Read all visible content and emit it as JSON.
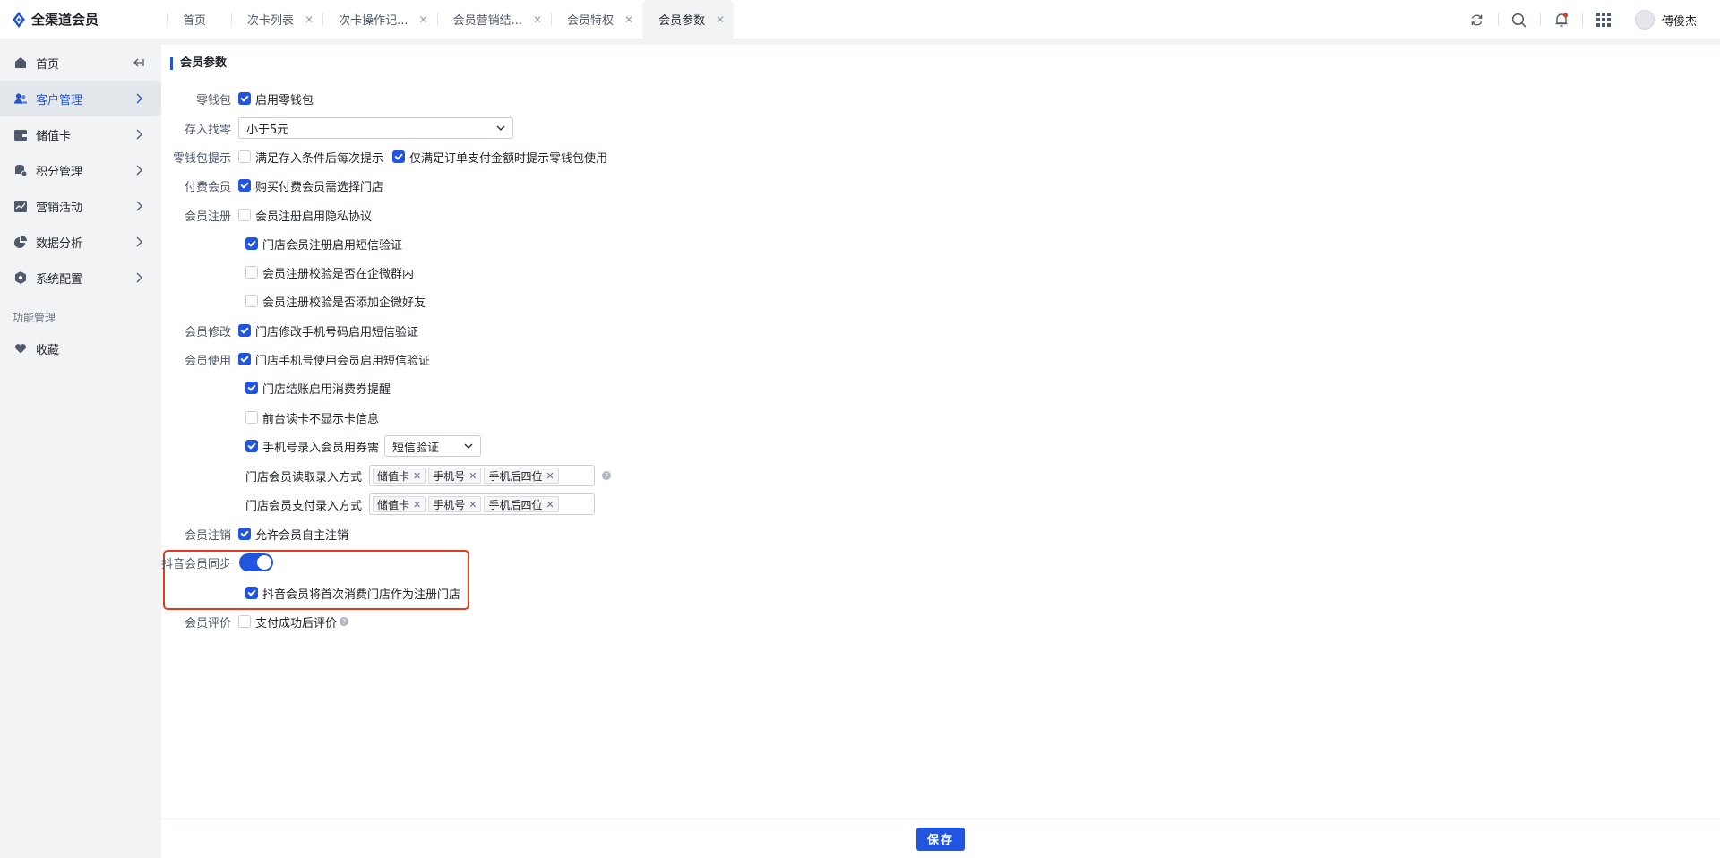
{
  "app": {
    "title": "全渠道会员",
    "accent": "#2155e0"
  },
  "tabs": [
    {
      "label": "首页",
      "closable": false
    },
    {
      "label": "次卡列表",
      "closable": true
    },
    {
      "label": "次卡操作记...",
      "closable": true
    },
    {
      "label": "会员营销结...",
      "closable": true
    },
    {
      "label": "会员特权",
      "closable": true
    },
    {
      "label": "会员参数",
      "closable": true,
      "active": true
    }
  ],
  "user": {
    "name": "傅俊杰"
  },
  "sidebar": {
    "items": [
      {
        "label": "首页",
        "icon": "home-icon"
      },
      {
        "label": "客户管理",
        "icon": "users-icon",
        "active": true
      },
      {
        "label": "储值卡",
        "icon": "wallet-icon"
      },
      {
        "label": "积分管理",
        "icon": "database-icon"
      },
      {
        "label": "营销活动",
        "icon": "chart-icon"
      },
      {
        "label": "数据分析",
        "icon": "pie-icon"
      },
      {
        "label": "系统配置",
        "icon": "hexagon-icon"
      }
    ],
    "section": "功能管理",
    "fav": "收藏"
  },
  "form": {
    "title": "会员参数",
    "wallet": {
      "label": "零钱包",
      "opt": "启用零钱包",
      "checked": true
    },
    "change": {
      "label": "存入找零",
      "value": "小于5元"
    },
    "wallet_tip": {
      "label": "零钱包提示",
      "opt1": "满足存入条件后每次提示",
      "opt2": "仅满足订单支付金额时提示零钱包使用"
    },
    "paid": {
      "label": "付费会员",
      "opt": "购买付费会员需选择门店"
    },
    "register": {
      "label": "会员注册",
      "opt1": "会员注册启用隐私协议",
      "opt2": "门店会员注册启用短信验证",
      "opt3": "会员注册校验是否在企微群内",
      "opt4": "会员注册校验是否添加企微好友"
    },
    "modify": {
      "label": "会员修改",
      "opt": "门店修改手机号码启用短信验证"
    },
    "use": {
      "label": "会员使用",
      "opt1": "门店手机号使用会员启用短信验证",
      "opt2": "门店结账启用消费券提醒",
      "opt3": "前台读卡不显示卡信息",
      "opt4": "手机号录入会员用券需",
      "opt4_select": "短信验证",
      "read_label": "门店会员读取录入方式",
      "pay_label": "门店会员支付录入方式",
      "tags": [
        "储值卡",
        "手机号",
        "手机后四位"
      ]
    },
    "cancel": {
      "label": "会员注销",
      "opt": "允许会员自主注销"
    },
    "douyin": {
      "label": "抖音会员同步",
      "switch_on": true,
      "opt": "抖音会员将首次消费门店作为注册门店"
    },
    "review": {
      "label": "会员评价",
      "opt": "支付成功后评价"
    }
  },
  "footer": {
    "save": "保存"
  }
}
